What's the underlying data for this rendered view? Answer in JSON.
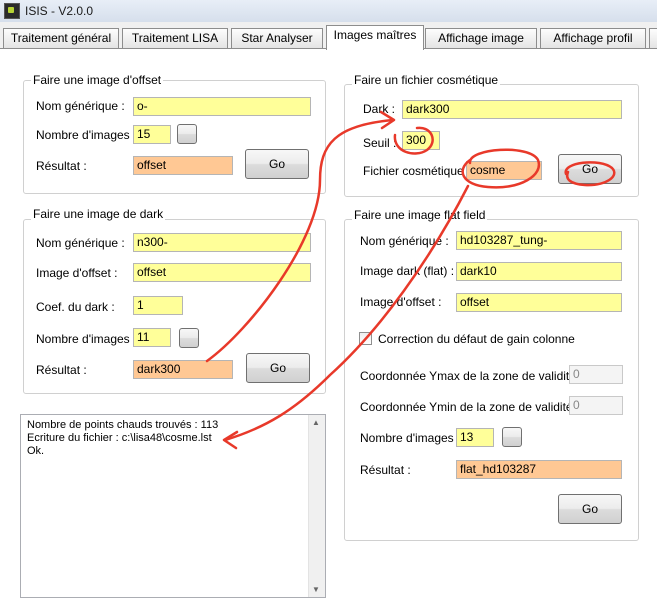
{
  "window": {
    "title": "ISIS - V2.0.0"
  },
  "tabs": [
    {
      "label": "Traitement général"
    },
    {
      "label": "Traitement LISA"
    },
    {
      "label": "Star Analyser"
    },
    {
      "label": "Images maîtres"
    },
    {
      "label": "Affichage image"
    },
    {
      "label": "Affichage profil"
    }
  ],
  "offset": {
    "title": "Faire une image d'offset",
    "generic_label": "Nom générique :",
    "generic_value": "o-",
    "count_label": "Nombre d'images :",
    "count_value": "15",
    "result_label": "Résultat :",
    "result_value": "offset",
    "go_label": "Go"
  },
  "dark": {
    "title": "Faire une image de dark",
    "generic_label": "Nom générique :",
    "generic_value": "n300-",
    "offset_label": "Image d'offset :",
    "offset_value": "offset",
    "coef_label": "Coef. du dark :",
    "coef_value": "1",
    "count_label": "Nombre d'images :",
    "count_value": "11",
    "result_label": "Résultat :",
    "result_value": "dark300",
    "go_label": "Go"
  },
  "cosmetic": {
    "title": "Faire un fichier cosmétique",
    "dark_label": "Dark :",
    "dark_value": "dark300",
    "threshold_label": "Seuil :",
    "threshold_value": "300",
    "file_label": "Fichier cosmétique :",
    "file_value": "cosme",
    "go_label": "Go"
  },
  "flat": {
    "title": "Faire une image flat field",
    "generic_label": "Nom générique :",
    "generic_value": "hd103287_tung-",
    "dark_label": "Image dark (flat) :",
    "dark_value": "dark10",
    "offset_label": "Image d'offset :",
    "offset_value": "offset",
    "gain_label": "Correction du défaut de gain colonne",
    "ymax_label": "Coordonnée Ymax de la zone de validitée :",
    "ymax_value": "0",
    "ymin_label": "Coordonnée Ymin de la zone de validitée :",
    "ymin_value": "0",
    "count_label": "Nombre d'images :",
    "count_value": "13",
    "result_label": "Résultat :",
    "result_value": "flat_hd103287",
    "go_label": "Go"
  },
  "log": {
    "lines": [
      "Nombre de points chauds trouvés : 113",
      "Ecriture du fichier : c:\\lisa48\\cosme.lst",
      "Ok."
    ]
  },
  "colors": {
    "input_yellow": "#ffff99",
    "result_orange": "#ffc894",
    "annotation_red": "#e8392a"
  },
  "icons": {
    "app": "isis-app-icon",
    "buttons": "ellipsis-button"
  }
}
